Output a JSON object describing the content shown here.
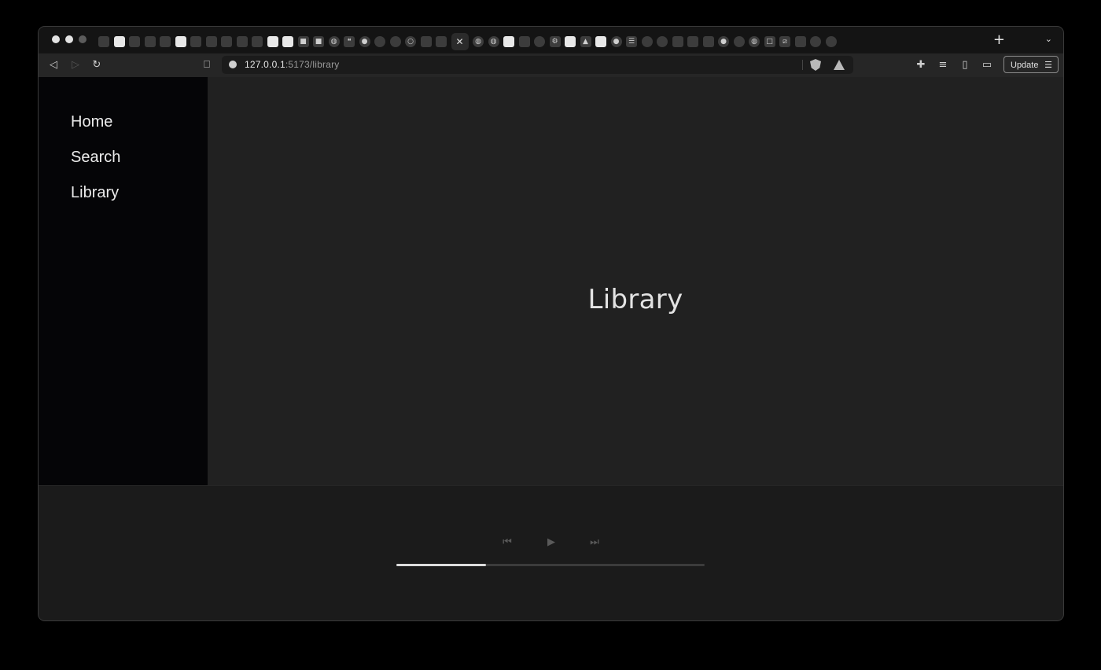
{
  "browser": {
    "url_host": "127.0.0.1",
    "url_path": ":5173/library",
    "update_label": "Update",
    "tab_icons": [
      "youtube-icon",
      "wordpress-icon",
      "diamond-icon",
      "figma-icon",
      "layers-icon",
      "wordpress-icon",
      "hexagon-icon",
      "slack-icon",
      "gitlab-icon",
      "gitlab-icon",
      "cloud-icon",
      "excel-icon",
      "folder-icon",
      "video-icon",
      "video-icon",
      "globe-icon",
      "quote-icon",
      "github-icon",
      "react-icon",
      "vue-icon",
      "circle-icon",
      "spiral-icon",
      "swift-icon",
      "close-icon",
      "globe-icon",
      "globe-icon",
      "docs-icon",
      "diamond-icon",
      "android-icon",
      "gear-icon",
      "wordpress-icon",
      "triangle-icon",
      "calendar-icon",
      "github-icon",
      "list-icon",
      "brain-icon",
      "vue-icon",
      "diamond-icon",
      "gitlab-icon",
      "dark-icon",
      "github-icon",
      "vue-icon",
      "globe-icon",
      "square-icon",
      "slash-icon",
      "gitlab-icon",
      "vue-icon",
      "chrome-icon"
    ],
    "new_tab_label": "+",
    "tab_menu_label": "⌄"
  },
  "sidebar": {
    "items": [
      {
        "label": "Home"
      },
      {
        "label": "Search"
      },
      {
        "label": "Library"
      }
    ]
  },
  "main": {
    "title": "Library"
  },
  "player": {
    "progress": 0.29,
    "prev_icon": "skip-back-icon",
    "play_icon": "play-icon",
    "next_icon": "skip-forward-icon"
  }
}
